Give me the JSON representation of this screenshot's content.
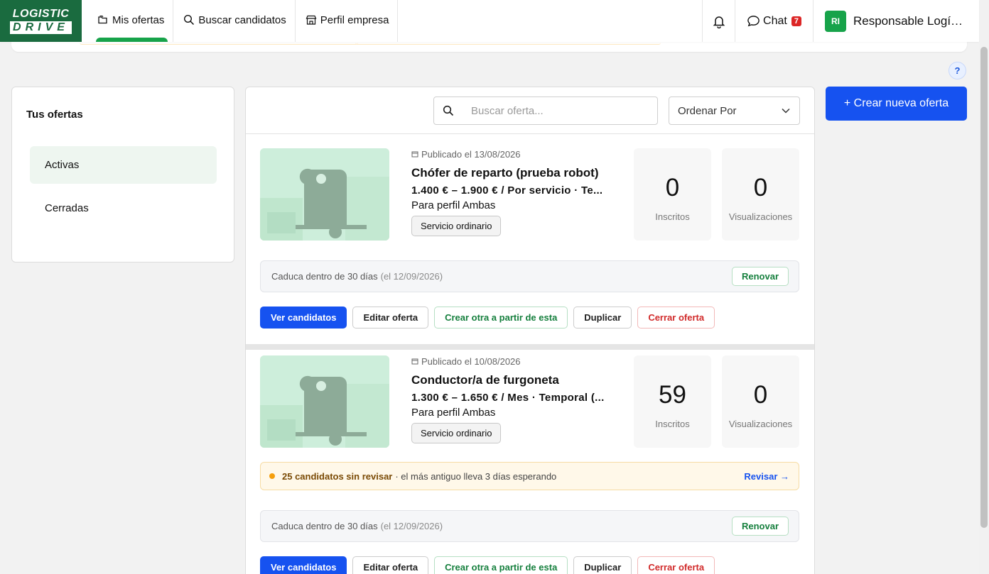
{
  "logo": {
    "line1": "LOGISTIC",
    "line2": "DRIVE"
  },
  "nav": {
    "items": [
      {
        "label": "Mis ofertas",
        "icon": "folders-icon"
      },
      {
        "label": "Buscar candidatos",
        "icon": "search-icon"
      },
      {
        "label": "Perfil empresa",
        "icon": "store-icon"
      }
    ],
    "chat_label": "Chat",
    "chat_badge": "7",
    "user_initials": "RI",
    "user_name": "Responsable Logí…"
  },
  "help_label": "?",
  "sidebar": {
    "title": "Tus ofertas",
    "items": [
      {
        "label": "Activas"
      },
      {
        "label": "Cerradas"
      }
    ]
  },
  "search": {
    "placeholder": "Buscar oferta..."
  },
  "sort": {
    "label": "Ordenar Por"
  },
  "create_button": "+ Crear nueva oferta",
  "offers": [
    {
      "published": "Publicado el 13/08/2026",
      "title": "Chófer de reparto (prueba robot)",
      "salary": "1.400 € – 1.900 € / Por servicio · Te...",
      "profile": "Para perfil Ambas",
      "chip": "Servicio ordinario",
      "registered": "0",
      "registered_label": "Inscritos",
      "views": "0",
      "views_label": "Visualizaciones",
      "expiry": "Caduca dentro de 30 días",
      "expiry_date": "(el 12/09/2026)",
      "renew": "Renovar",
      "actions": {
        "view": "Ver candidatos",
        "edit": "Editar oferta",
        "create_from": "Crear otra a partir de esta",
        "duplicate": "Duplicar",
        "close": "Cerrar oferta"
      }
    },
    {
      "published": "Publicado el 10/08/2026",
      "title": "Conductor/a de furgoneta",
      "salary": "1.300 € – 1.650 € / Mes · Temporal (...",
      "profile": "Para perfil Ambas",
      "chip": "Servicio ordinario",
      "registered": "59",
      "registered_label": "Inscritos",
      "views": "0",
      "views_label": "Visualizaciones",
      "alert_bold": "25 candidatos sin revisar",
      "alert_text": "· el más antiguo lleva 3 días esperando",
      "alert_action": "Revisar →",
      "expiry": "Caduca dentro de 30 días",
      "expiry_date": "(el 12/09/2026)",
      "renew": "Renovar",
      "actions": {
        "view": "Ver candidatos",
        "edit": "Editar oferta",
        "create_from": "Crear otra a partir de esta",
        "duplicate": "Duplicar",
        "close": "Cerrar oferta"
      }
    }
  ],
  "colors": {
    "brand_green": "#1a6b3f",
    "primary_blue": "#1652f0",
    "accent_green": "#17a34a",
    "danger": "#d12b2b"
  }
}
